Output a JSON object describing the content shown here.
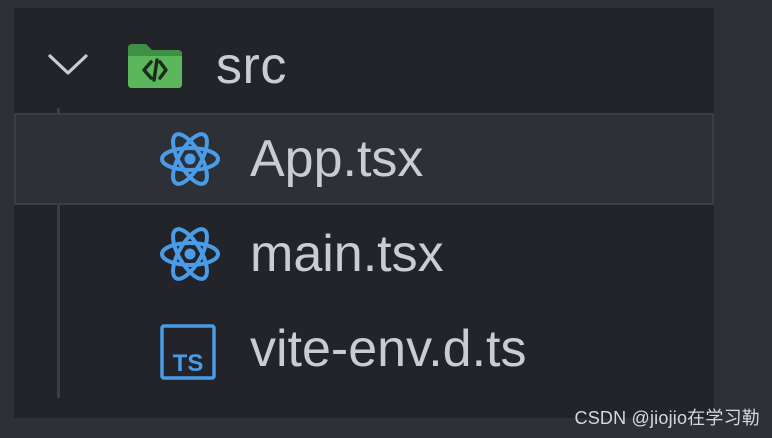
{
  "explorer": {
    "folder": {
      "name": "src",
      "expanded": true,
      "icon": "code-folder-icon",
      "icon_color": "#5bb75b"
    },
    "files": [
      {
        "name": "App.tsx",
        "icon": "react-icon",
        "icon_color": "#4a9be8",
        "selected": true
      },
      {
        "name": "main.tsx",
        "icon": "react-icon",
        "icon_color": "#4a9be8",
        "selected": false
      },
      {
        "name": "vite-env.d.ts",
        "icon": "typescript-icon",
        "icon_color": "#4a9be8",
        "selected": false
      }
    ]
  },
  "watermark": {
    "text": "CSDN @jiojio在学习勒"
  },
  "colors": {
    "background": "#222429",
    "text": "#c9ccd2",
    "selection": "#2d3037",
    "tree_guide": "#3b3e45"
  }
}
